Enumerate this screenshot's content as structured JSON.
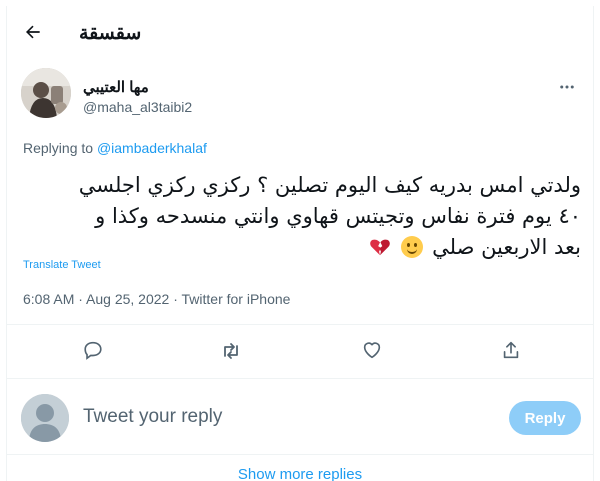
{
  "header": {
    "title": "سقسقة",
    "back_icon": "arrow-left-icon"
  },
  "author": {
    "name": "مها العتيبي",
    "handle": "@maha_al3taibi2",
    "more_icon": "more-horizontal-icon"
  },
  "replying": {
    "prefix": "Replying to ",
    "mention": "@iambaderkhalaf"
  },
  "tweet": {
    "line1": "ولدتي امس بدريه كيف اليوم تصلين ؟ ركزي ركزي اجلسي",
    "line2": "٤٠ يوم فترة نفاس وتجيتس قهاوي وانتي منسدحه وكذا و",
    "line3": "بعد الاربعين صلي",
    "emoji": [
      "slightly-smiling-face",
      "broken-heart"
    ]
  },
  "translate_label": "Translate Tweet",
  "meta": "6:08 AM · Aug 25, 2022 · Twitter for iPhone",
  "actions": [
    "reply-icon",
    "retweet-icon",
    "like-icon",
    "share-icon"
  ],
  "reply_box": {
    "placeholder": "Tweet your reply",
    "button_label": "Reply"
  },
  "show_more": "Show more replies",
  "colors": {
    "accent": "#1d9bf0",
    "reply_button": "#8ecdf8",
    "secondary_text": "#536471"
  }
}
